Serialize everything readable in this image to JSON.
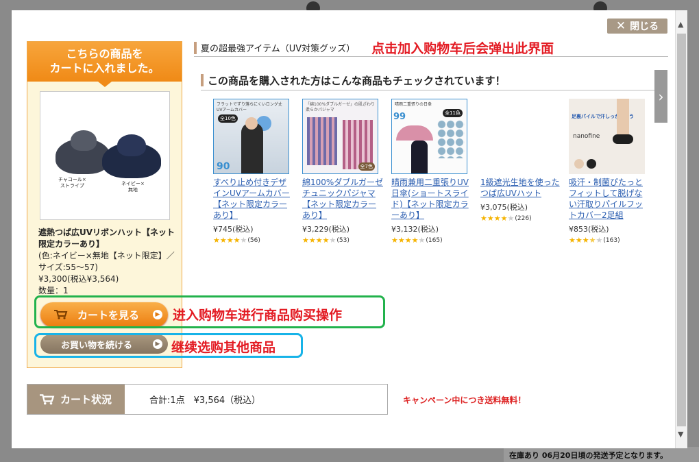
{
  "modal": {
    "close_label": "閉じる",
    "added_header_line1": "こちらの商品を",
    "added_header_line2": "カートに入れました。",
    "section_title": "夏の超最強アイテム（UV対策グッズ）",
    "recommend_title": "この商品を購入された方はこんな商品もチェックされています！"
  },
  "added_item": {
    "image_label_left": "チャコール×\nストライプ",
    "image_label_right": "ネイビー×\n無地",
    "name": "遮熱つば広UVリボンハット【ネット限定カラーあり】",
    "option": "(色:ネイビー×無地【ネット限定】／サイズ:55～57)",
    "price": "¥3,300(税込¥3,564)",
    "quantity": "数量：1"
  },
  "buttons": {
    "view_cart": "カートを見る",
    "continue_shopping": "お買い物を続ける"
  },
  "annotations": {
    "popup": "点击加入购物车后会弹出此界面",
    "view_cart": "进入购物车进行商品购买操作",
    "continue": "继续选购其他商品"
  },
  "products": [
    {
      "name": "すべり止め付きデザインUVアームカバー【ネット限定カラーあり】",
      "price": "¥745(税込)",
      "rating": 4,
      "reviews": "(56)",
      "badge": "90",
      "image_caption": "フラットでずり落ちにくいロング丈UVアームカバー",
      "tag": "全10色"
    },
    {
      "name": "綿100%ダブルガーゼチュニックパジャマ【ネット限定カラーあり】",
      "price": "¥3,229(税込)",
      "rating": 4,
      "reviews": "(53)",
      "badge": "",
      "image_caption": "「綿100%ダブルガーゼ」の肌ざわり柔らかパジャマ",
      "tag": "全7色"
    },
    {
      "name": "晴雨兼用二重張りUV日傘(ショートスライド)【ネット限定カラーあり】",
      "price": "¥3,132(税込)",
      "rating": 4,
      "reviews": "(165)",
      "badge": "99",
      "image_caption": "晴雨二重張りの日傘",
      "tag": "全11色"
    },
    {
      "name": "1級遮光生地を使ったつば広UVハット",
      "price": "¥3,075(税込)",
      "rating": 4,
      "reviews": "(226)",
      "badge": "",
      "image_caption": "",
      "tag": ""
    },
    {
      "name": "吸汗・制菌ぴたっとフィットして脱げない汗取りパイルフットカバー2足組",
      "price": "¥853(税込)",
      "rating": 3.5,
      "reviews": "(163)",
      "badge": "",
      "image_caption": "足裏パイルで汗しっかり吸う",
      "tag": "nanofine"
    }
  ],
  "cart_status": {
    "label": "カート状況",
    "summary": "合計:1点　¥3,564（税込）",
    "campaign": "キャンペーン中につき送料無料！"
  },
  "background": {
    "bottom_notice": "在庫あり 06月20日頃の発送予定となります。"
  },
  "colors": {
    "orange_accent": "#f08a16",
    "taupe": "#a7957f",
    "link_blue": "#2a5db0",
    "annotation_red": "#e31b23",
    "annotation_green": "#22b24c",
    "annotation_blue": "#17b3e8"
  }
}
